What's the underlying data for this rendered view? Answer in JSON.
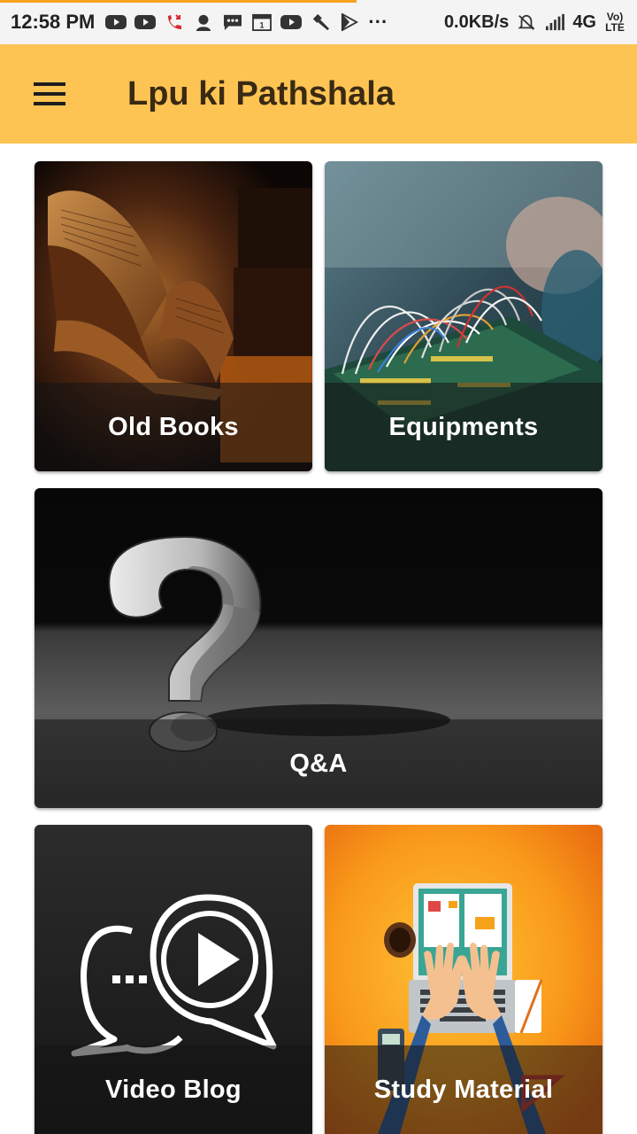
{
  "status_bar": {
    "time": "12:58 PM",
    "dots": "···",
    "network_speed": "0.0KB/s",
    "network_type": "4G",
    "volte_label": "Vo) LTE",
    "page_load_progress": 0.56
  },
  "app_bar": {
    "title": "Lpu ki Pathshala",
    "menu_icon": "hamburger-menu-icon"
  },
  "tiles": [
    {
      "label": "Old Books"
    },
    {
      "label": "Equipments"
    },
    {
      "label": "Q&A"
    },
    {
      "label": "Video Blog"
    },
    {
      "label": "Study Material"
    }
  ],
  "colors": {
    "app_bar": "#fdc453",
    "title_text": "#3a2a14",
    "progress": "#f7a21b"
  }
}
